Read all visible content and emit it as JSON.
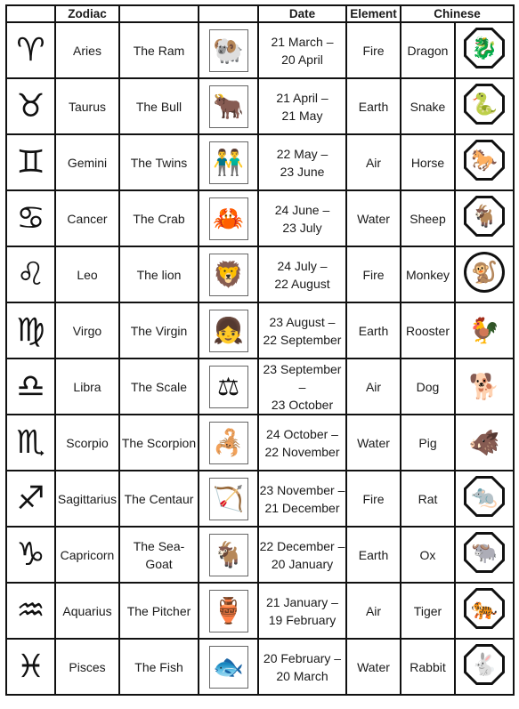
{
  "headers": {
    "col1": "",
    "zodiac": "Zodiac",
    "col3": "",
    "col4": "",
    "date": "Date",
    "element": "Element",
    "chinese": "Chinese"
  },
  "rows": [
    {
      "symbol": "♈",
      "sign": "Aries",
      "name": "The Ram",
      "picture_icon": "ram-icon",
      "picture_glyph": "🐏",
      "date_start": "21 March –",
      "date_end": "20 April",
      "element": "Fire",
      "chinese": "Dragon",
      "chinese_icon": "dragon-icon",
      "chinese_glyph": "🐉",
      "chinese_frame": "octagon"
    },
    {
      "symbol": "♉",
      "sign": "Taurus",
      "name": "The Bull",
      "picture_icon": "bull-icon",
      "picture_glyph": "🐂",
      "date_start": "21 April –",
      "date_end": "21 May",
      "element": "Earth",
      "chinese": "Snake",
      "chinese_icon": "snake-icon",
      "chinese_glyph": "🐍",
      "chinese_frame": "octagon"
    },
    {
      "symbol": "♊",
      "sign": "Gemini",
      "name": "The Twins",
      "picture_icon": "twins-icon",
      "picture_glyph": "👬",
      "date_start": "22 May –",
      "date_end": "23 June",
      "element": "Air",
      "chinese": "Horse",
      "chinese_icon": "horse-icon",
      "chinese_glyph": "🐎",
      "chinese_frame": "octagon"
    },
    {
      "symbol": "♋",
      "sign": "Cancer",
      "name": "The Crab",
      "picture_icon": "crab-icon",
      "picture_glyph": "🦀",
      "date_start": "24 June –",
      "date_end": "23 July",
      "element": "Water",
      "chinese": "Sheep",
      "chinese_icon": "sheep-icon",
      "chinese_glyph": "🐐",
      "chinese_frame": "octagon"
    },
    {
      "symbol": "♌",
      "sign": "Leo",
      "name": "The lion",
      "picture_icon": "lion-icon",
      "picture_glyph": "🦁",
      "date_start": "24 July –",
      "date_end": "22 August",
      "element": "Fire",
      "chinese": "Monkey",
      "chinese_icon": "monkey-icon",
      "chinese_glyph": "🐒",
      "chinese_frame": "circle"
    },
    {
      "symbol": "♍",
      "sign": "Virgo",
      "name": "The Virgin",
      "picture_icon": "virgin-icon",
      "picture_glyph": "👧",
      "date_start": "23 August –",
      "date_end": "22 September",
      "element": "Earth",
      "chinese": "Rooster",
      "chinese_icon": "rooster-icon",
      "chinese_glyph": "🐓",
      "chinese_frame": "none"
    },
    {
      "symbol": "♎",
      "sign": "Libra",
      "name": "The Scale",
      "picture_icon": "scale-icon",
      "picture_glyph": "⚖",
      "date_start": "23 September –",
      "date_end": "23 October",
      "element": "Air",
      "chinese": "Dog",
      "chinese_icon": "dog-icon",
      "chinese_glyph": "🐕",
      "chinese_frame": "none"
    },
    {
      "symbol": "♏",
      "sign": "Scorpio",
      "name": "The Scorpion",
      "picture_icon": "scorpion-icon",
      "picture_glyph": "🦂",
      "date_start": "24 October –",
      "date_end": "22 November",
      "element": "Water",
      "chinese": "Pig",
      "chinese_icon": "pig-icon",
      "chinese_glyph": "🐗",
      "chinese_frame": "none"
    },
    {
      "symbol": "♐",
      "sign": "Sagittarius",
      "name": "The Centaur",
      "picture_icon": "archer-icon",
      "picture_glyph": "🏹",
      "date_start": "23 November –",
      "date_end": "21 December",
      "element": "Fire",
      "chinese": "Rat",
      "chinese_icon": "rat-icon",
      "chinese_glyph": "🐀",
      "chinese_frame": "octagon"
    },
    {
      "symbol": "♑",
      "sign": "Capricorn",
      "name": "The Sea-Goat",
      "picture_icon": "goat-icon",
      "picture_glyph": "🐐",
      "date_start": "22 December –",
      "date_end": "20 January",
      "element": "Earth",
      "chinese": "Ox",
      "chinese_icon": "ox-icon",
      "chinese_glyph": "🐃",
      "chinese_frame": "octagon"
    },
    {
      "symbol": "♒",
      "sign": "Aquarius",
      "name": "The Pitcher",
      "picture_icon": "water-bearer-icon",
      "picture_glyph": "🏺",
      "date_start": "21 January –",
      "date_end": "19 February",
      "element": "Air",
      "chinese": "Tiger",
      "chinese_icon": "tiger-icon",
      "chinese_glyph": "🐅",
      "chinese_frame": "octagon"
    },
    {
      "symbol": "♓",
      "sign": "Pisces",
      "name": "The Fish",
      "picture_icon": "fish-icon",
      "picture_glyph": "🐟",
      "date_start": "20 February –",
      "date_end": "20 March",
      "element": "Water",
      "chinese": "Rabbit",
      "chinese_icon": "rabbit-icon",
      "chinese_glyph": "🐇",
      "chinese_frame": "octagon"
    }
  ]
}
